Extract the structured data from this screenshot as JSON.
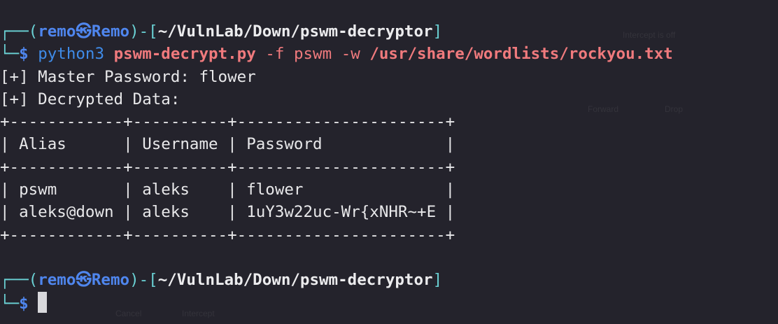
{
  "window": {
    "ghost_texts": [
      "Intercept is off",
      "Cancel",
      "Intercept",
      "Forward",
      "Drop"
    ]
  },
  "prompt": {
    "corner_top": "┌──",
    "open_paren": "(",
    "user": "remo",
    "separator_icon": "㉿",
    "host": "Remo",
    "close_paren": ")",
    "dash": "-",
    "open_bracket": "[",
    "cwd": "~/VulnLab/Down/pswm-decryptor",
    "close_bracket": "]",
    "corner_bottom": "└─",
    "symbol": "$"
  },
  "command": {
    "program": "python3",
    "script": "pswm-decrypt.py",
    "flag_file": "-f",
    "file_value": "pswm",
    "flag_wordlist": "-w",
    "wordlist_value": "/usr/share/wordlists/rockyou.txt"
  },
  "output": {
    "master_password_line": "[+] Master Password: flower",
    "decrypted_data_line": "[+] Decrypted Data:",
    "table_lines": [
      "+------------+----------+----------------------+",
      "| Alias      | Username | Password             |",
      "+------------+----------+----------------------+",
      "| pswm       | aleks    | flower               |",
      "| aleks@down | aleks    | 1uY3w22uc-Wr{xNHR~+E |",
      "+------------+----------+----------------------+"
    ]
  },
  "colors": {
    "background": "#24232c",
    "frame": "#6ad1d4",
    "user_host": "#4f86ee",
    "argument": "#f07a7d",
    "command": "#3f8be8"
  }
}
